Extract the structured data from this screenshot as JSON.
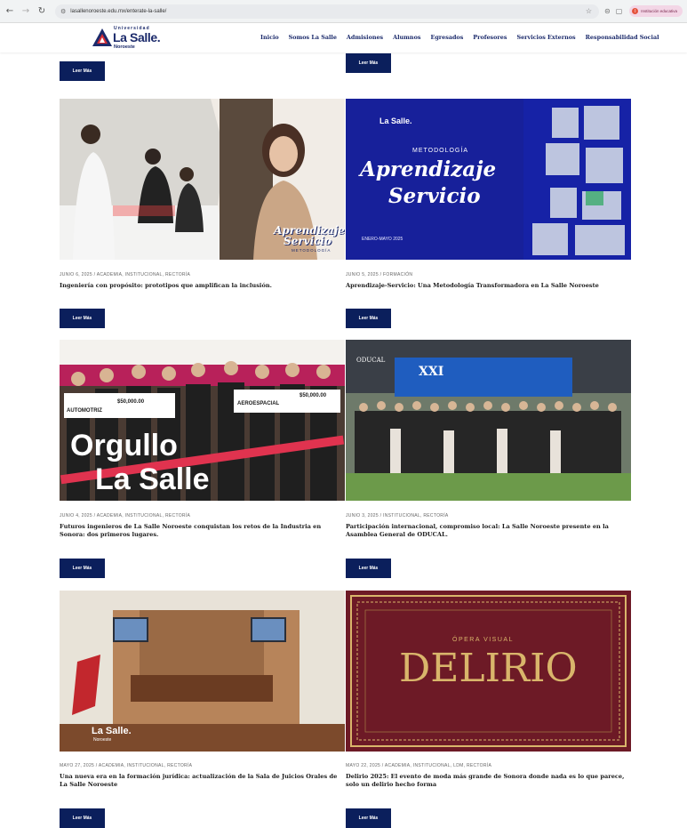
{
  "browser": {
    "url": "lasallenoroeste.edu.mx/enterate-la-salle/",
    "profile_label": "Institución educativa",
    "profile_initial": "I"
  },
  "site": {
    "logo_univ": "Universidad",
    "logo_name": "La Salle.",
    "logo_sub": "Noroeste",
    "nav": [
      "Inicio",
      "Somos La Salle",
      "Admisiones",
      "Alumnos",
      "Egresados",
      "Profesores",
      "Servicios Externos",
      "Responsabilidad Social"
    ]
  },
  "read_more": "Leer Más",
  "posts": [
    {
      "meta": "JUNIO 6, 2025 / ACADEMIA, INSTITUCIONAL, RECTORÍA",
      "title": "Ingeniería con propósito: prototipos que amplifican la inclusión.",
      "image_text": [
        "Aprendizaje",
        "Servicio",
        "METODOLOGÍA"
      ]
    },
    {
      "meta": "JUNIO 5, 2025 / FORMACIÓN",
      "title": "Aprendizaje-Servicio: Una Metodología Transformadora en La Salle Noroeste",
      "image_text": [
        "METODOLOGÍA",
        "Aprendizaje",
        "Servicio",
        "ENERO-MAYO 2025"
      ]
    },
    {
      "meta": "JUNIO 4, 2025 / ACADEMIA, INSTITUCIONAL, RECTORÍA",
      "title": "Futuros ingenieros de La Salle Noroeste conquistan los retos de la Industria en Sonora: dos primeros lugares.",
      "image_text": [
        "Orgullo",
        "La Salle",
        "$50,000.00",
        "AUTOMOTRIZ",
        "AEROESPACIAL"
      ]
    },
    {
      "meta": "JUNIO 3, 2025 / INSTITUCIONAL, RECTORÍA",
      "title": "Participación internacional, compromiso local: La Salle Noroeste presente en la Asamblea General de ODUCAL.",
      "image_text": [
        "ODUCAL",
        "XXI"
      ]
    },
    {
      "meta": "MAYO 27, 2025 / ACADEMIA, INSTITUCIONAL, RECTORÍA",
      "title": "Una nueva era en la formación jurídica: actualización de la Sala de Juicios Orales de La Salle Noroeste",
      "image_text": [
        "La Salle.",
        "Noroeste"
      ]
    },
    {
      "meta": "MAYO 22, 2025 / ACADEMIA, INSTITUCIONAL, LDM, RECTORÍA",
      "title": "Delirio 2025: El evento de moda más grande de Sonora donde nada es lo que parece, solo un delirio hecho forma",
      "image_text": [
        "ÓPERA VISUAL",
        "DELIRIO"
      ]
    }
  ],
  "colors": {
    "brand_navy": "#0b1f5c",
    "brand_blue": "#1b2a6b",
    "delirio_red": "#6d1a26",
    "delirio_gold": "#d9b56b"
  }
}
